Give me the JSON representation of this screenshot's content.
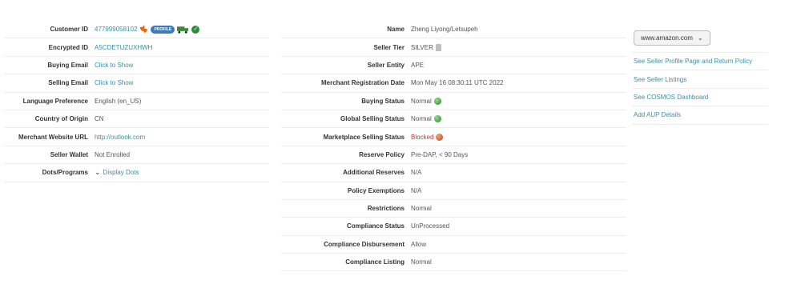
{
  "left": {
    "customer_id": {
      "label": "Customer ID",
      "value": "477999058102"
    },
    "encrypted_id": {
      "label": "Encrypted ID",
      "value": "A5CDETUZUXHWH"
    },
    "buying_email": {
      "label": "Buying Email",
      "value": "Click to Show"
    },
    "selling_email": {
      "label": "Selling Email",
      "value": "Click to Show"
    },
    "language_preference": {
      "label": "Language Preference",
      "value": "English (en_US)"
    },
    "country_of_origin": {
      "label": "Country of Origin",
      "value": "CN"
    },
    "merchant_website_url": {
      "label": "Merchant Website URL",
      "value": "http://outlook.com"
    },
    "seller_wallet": {
      "label": "Seller Wallet",
      "value": "Not Enrolled"
    },
    "dots_programs": {
      "label": "Dots/Programs",
      "value": "Display Dots"
    }
  },
  "middle": {
    "name": {
      "label": "Name",
      "value": "Zheng Liyong/Letsupeh"
    },
    "seller_tier": {
      "label": "Seller Tier",
      "value": "SILVER"
    },
    "seller_entity": {
      "label": "Seller Entity",
      "value": "APE"
    },
    "merchant_registration_date": {
      "label": "Merchant Registration Date",
      "value": "Mon May 16 08:30:11 UTC 2022"
    },
    "buying_status": {
      "label": "Buying Status",
      "value": "Normal"
    },
    "global_selling_status": {
      "label": "Global Selling Status",
      "value": "Normal"
    },
    "marketplace_selling_status": {
      "label": "Marketplace Selling Status",
      "value": "Blocked"
    },
    "reserve_policy": {
      "label": "Reserve Policy",
      "value": "Pre-DAP, < 90 Days"
    },
    "additional_reserves": {
      "label": "Additional Reserves",
      "value": "N/A"
    },
    "policy_exemptions": {
      "label": "Policy Exemptions",
      "value": "N/A"
    },
    "restrictions": {
      "label": "Restrictions",
      "value": "Normal"
    },
    "compliance_status": {
      "label": "Compliance Status",
      "value": "UnProcessed"
    },
    "compliance_disbursement": {
      "label": "Compliance Disbursement",
      "value": "Allow"
    },
    "compliance_listing": {
      "label": "Compliance Listing",
      "value": "Normal"
    }
  },
  "right": {
    "marketplace_select": "www.amazon.com",
    "links": [
      "See Seller Profile Page and Return Policy",
      "See Seller Listings",
      "See COSMOS Dashboard",
      "Add AUP Details"
    ]
  },
  "icons": {
    "customer_flag": "texas-icon",
    "badge_text": "PROFILE",
    "status_ok_color": "#2e8b3d",
    "status_blocked_color": "#b5461a",
    "link_color": "#3a8fa6"
  }
}
